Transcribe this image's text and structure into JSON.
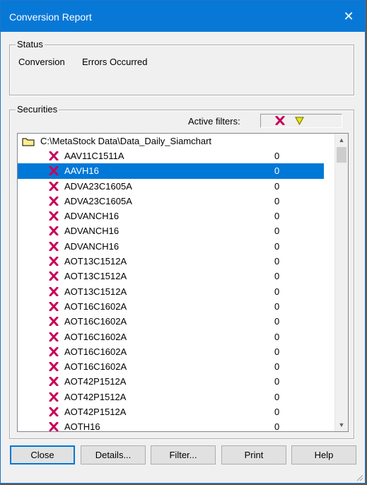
{
  "window": {
    "title": "Conversion Report"
  },
  "status": {
    "legend": "Status",
    "label": "Conversion",
    "value": "Errors Occurred"
  },
  "securities": {
    "legend": "Securities",
    "filters_label": "Active filters:",
    "folder_path": "C:\\MetaStock Data\\Data_Daily_Siamchart",
    "items": [
      {
        "name": "AAV11C1511A",
        "count": "0",
        "icon": "error-x-icon",
        "selected": false
      },
      {
        "name": "AAVH16",
        "count": "0",
        "icon": "error-x-icon",
        "selected": true
      },
      {
        "name": "ADVA23C1605A",
        "count": "0",
        "icon": "error-x-icon",
        "selected": false
      },
      {
        "name": "ADVA23C1605A",
        "count": "0",
        "icon": "error-x-icon",
        "selected": false
      },
      {
        "name": "ADVANCH16",
        "count": "0",
        "icon": "error-x-icon",
        "selected": false
      },
      {
        "name": "ADVANCH16",
        "count": "0",
        "icon": "error-x-icon",
        "selected": false
      },
      {
        "name": "ADVANCH16",
        "count": "0",
        "icon": "error-x-icon",
        "selected": false
      },
      {
        "name": "AOT13C1512A",
        "count": "0",
        "icon": "error-x-icon",
        "selected": false
      },
      {
        "name": "AOT13C1512A",
        "count": "0",
        "icon": "error-x-icon",
        "selected": false
      },
      {
        "name": "AOT13C1512A",
        "count": "0",
        "icon": "error-x-icon",
        "selected": false
      },
      {
        "name": "AOT16C1602A",
        "count": "0",
        "icon": "error-x-icon",
        "selected": false
      },
      {
        "name": "AOT16C1602A",
        "count": "0",
        "icon": "error-x-icon",
        "selected": false
      },
      {
        "name": "AOT16C1602A",
        "count": "0",
        "icon": "error-x-icon",
        "selected": false
      },
      {
        "name": "AOT16C1602A",
        "count": "0",
        "icon": "error-x-icon",
        "selected": false
      },
      {
        "name": "AOT16C1602A",
        "count": "0",
        "icon": "error-x-icon",
        "selected": false
      },
      {
        "name": "AOT42P1512A",
        "count": "0",
        "icon": "error-x-icon",
        "selected": false
      },
      {
        "name": "AOT42P1512A",
        "count": "0",
        "icon": "error-x-icon",
        "selected": false
      },
      {
        "name": "AOT42P1512A",
        "count": "0",
        "icon": "error-x-icon",
        "selected": false
      },
      {
        "name": "AOTH16",
        "count": "0",
        "icon": "error-x-icon",
        "selected": false
      }
    ]
  },
  "buttons": {
    "close": "Close",
    "details": "Details...",
    "filter": "Filter...",
    "print": "Print",
    "help": "Help"
  },
  "colors": {
    "title_bar": "#0878d7",
    "selection": "#0078d7",
    "error_x": "#c8005a",
    "filter_triangle": "#e8e800"
  }
}
